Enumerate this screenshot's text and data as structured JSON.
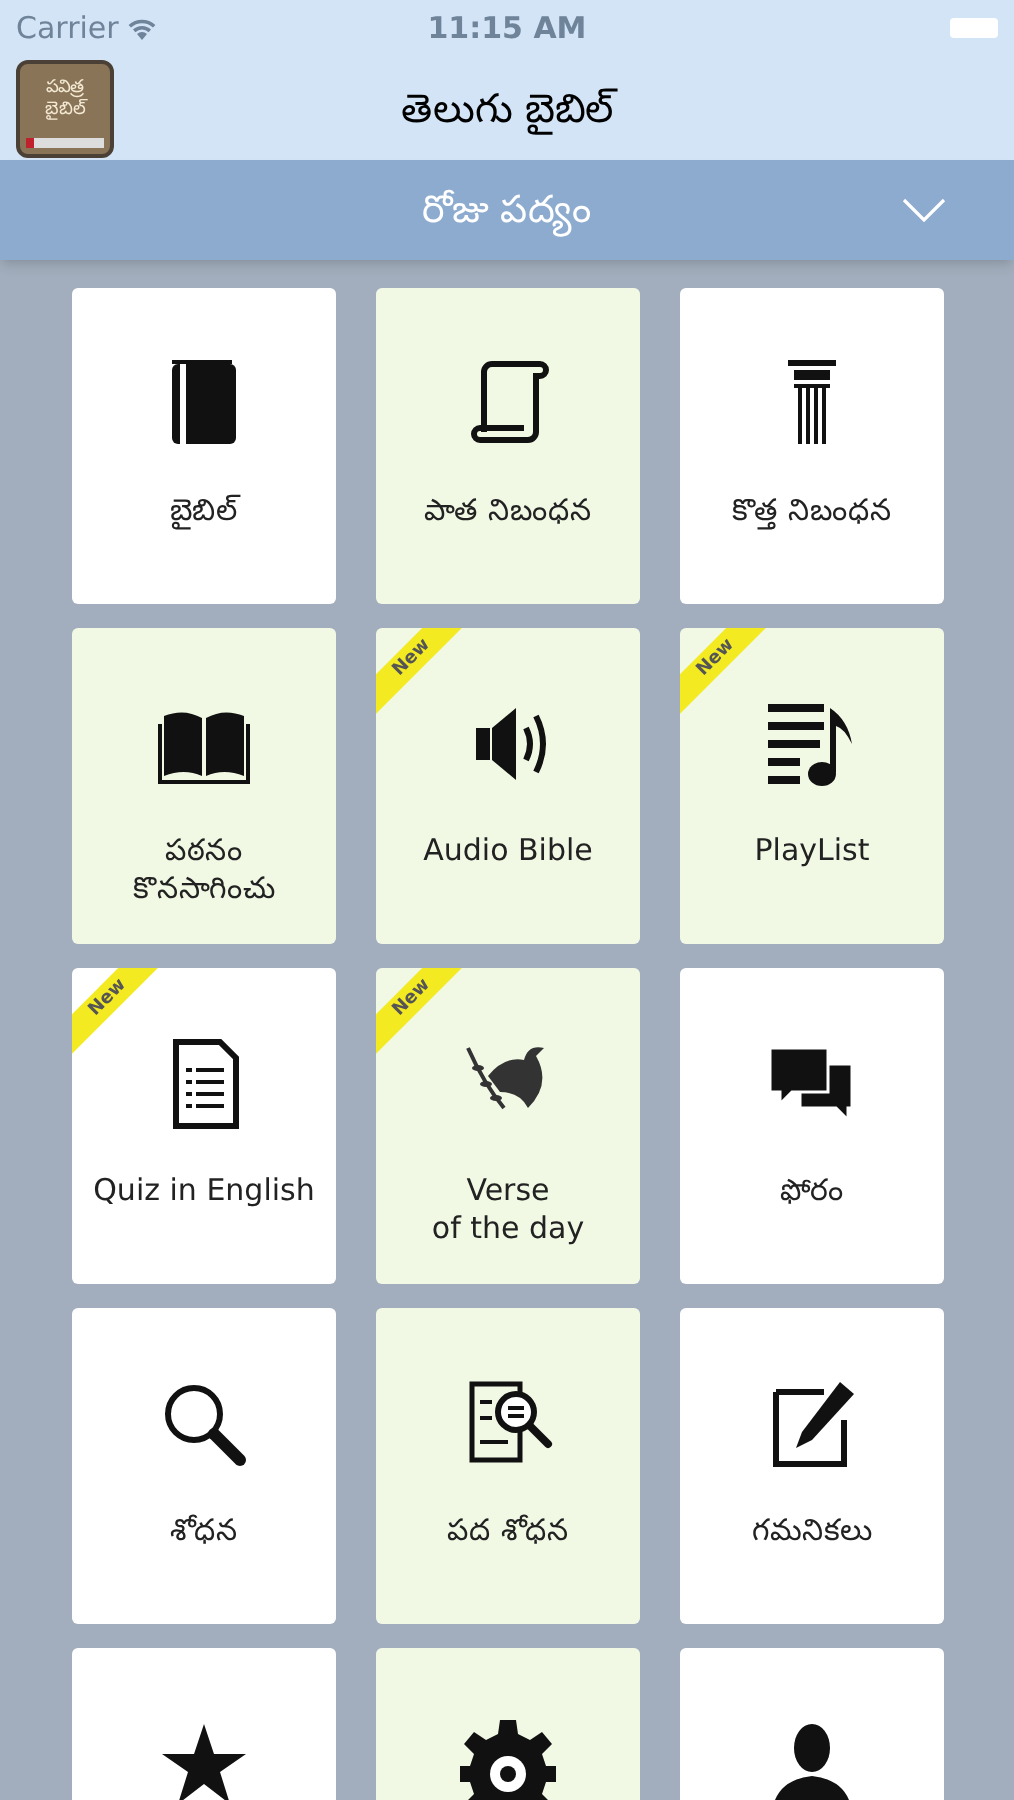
{
  "status_bar": {
    "carrier": "Carrier",
    "time": "11:15 AM"
  },
  "nav_bar": {
    "logo_text": "పవిత్ర బైబిల్",
    "title": "తెలుగు బైబిల్"
  },
  "dropdown": {
    "label": "రోజు పద్యం",
    "expanded": false
  },
  "tiles": [
    {
      "label": "బైబిల్",
      "tinted": false,
      "new": false
    },
    {
      "label": "పాత నిబంధన",
      "tinted": true,
      "new": false
    },
    {
      "label": "కొత్త నిబంధన",
      "tinted": false,
      "new": false
    },
    {
      "label": "పఠనం\nకొనసాగించు",
      "tinted": true,
      "new": false
    },
    {
      "label": "Audio Bible",
      "tinted": true,
      "new": true,
      "badge": "New"
    },
    {
      "label": "PlayList",
      "tinted": true,
      "new": true,
      "badge": "New"
    },
    {
      "label": "Quiz in English",
      "tinted": false,
      "new": true,
      "badge": "New"
    },
    {
      "label": "Verse\nof the day",
      "tinted": true,
      "new": true,
      "badge": "New"
    },
    {
      "label": "ఫోరం",
      "tinted": false,
      "new": false
    },
    {
      "label": "శోధన",
      "tinted": false,
      "new": false
    },
    {
      "label": "పద శోధన",
      "tinted": true,
      "new": false
    },
    {
      "label": "గమనికలు",
      "tinted": false,
      "new": false
    },
    {
      "tinted": false,
      "new": false
    },
    {
      "tinted": true,
      "new": false
    },
    {
      "tinted": false,
      "new": false
    }
  ]
}
